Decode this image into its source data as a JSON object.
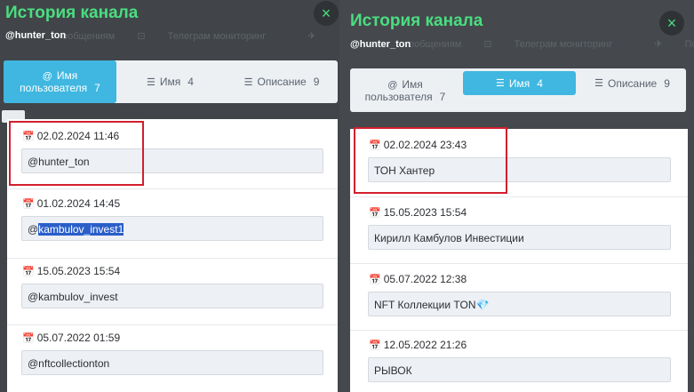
{
  "left": {
    "title": "История канала",
    "handle": "@hunter_ton",
    "close_icon": "×",
    "bg_nav": [
      "ообщениям",
      "Телеграм мониторинг"
    ],
    "tabs": [
      {
        "icon": "@",
        "label": "Имя пользователя",
        "count": "7",
        "active": true
      },
      {
        "icon": "☰",
        "label": "Имя",
        "count": "4",
        "active": false
      },
      {
        "icon": "☰",
        "label": "Описание",
        "count": "9",
        "active": false
      }
    ],
    "items": [
      {
        "date": "02.02.2024 11:46",
        "value": "@hunter_ton"
      },
      {
        "date": "01.02.2024 14:45",
        "value_prefix": "@",
        "value_selected": "kambulov_invest1"
      },
      {
        "date": "15.05.2023 15:54",
        "value": "@kambulov_invest"
      },
      {
        "date": "05.07.2022 01:59",
        "value": "@nftcollectionton"
      }
    ]
  },
  "right": {
    "title": "История канала",
    "handle": "@hunter_ton",
    "close_icon": "×",
    "bg_nav": [
      "ообщениям",
      "Телеграм мониторинг",
      "Поис"
    ],
    "tabs": [
      {
        "icon": "@",
        "label": "Имя пользователя",
        "count": "7",
        "active": false
      },
      {
        "icon": "☰",
        "label": "Имя",
        "count": "4",
        "active": true
      },
      {
        "icon": "☰",
        "label": "Описание",
        "count": "9",
        "active": false
      }
    ],
    "items": [
      {
        "date": "02.02.2024 23:43",
        "value": "ТОН Хантер"
      },
      {
        "date": "15.05.2023 15:54",
        "value": "Кирилл Камбулов Инвестиции"
      },
      {
        "date": "05.07.2022 12:38",
        "value": "NFT Коллекции TON💎"
      },
      {
        "date": "12.05.2022 21:26",
        "value": "РЫВОК"
      }
    ]
  },
  "icons": {
    "calendar": "calendar-icon",
    "close": "close-icon"
  },
  "colors": {
    "accent": "#3fb7e0",
    "title": "#4ade80",
    "highlight": "#d21f2e",
    "selection": "#2a5ec9"
  }
}
